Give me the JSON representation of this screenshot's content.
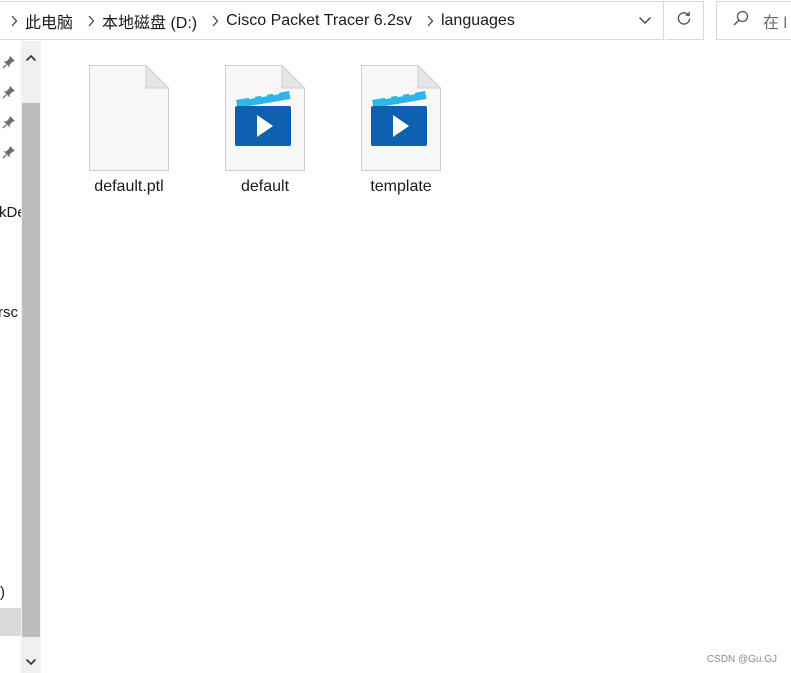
{
  "breadcrumb": [
    "此电脑",
    "本地磁盘 (D:)",
    "Cisco Packet Tracer 6.2sv",
    "languages"
  ],
  "search": {
    "placeholder": "在 l"
  },
  "nav": {
    "clipped_labels": [
      "kDe",
      "rsc",
      ")"
    ]
  },
  "files": [
    {
      "name": "default.ptl",
      "icon": "blank-document-icon"
    },
    {
      "name": "default",
      "icon": "video-file-icon"
    },
    {
      "name": "template",
      "icon": "video-file-icon"
    }
  ],
  "watermark": "CSDN @Gu.GJ",
  "colors": {
    "video_dark": "#0f5fb0",
    "video_light": "#2fb6e8",
    "border": "#d9d9d9"
  }
}
